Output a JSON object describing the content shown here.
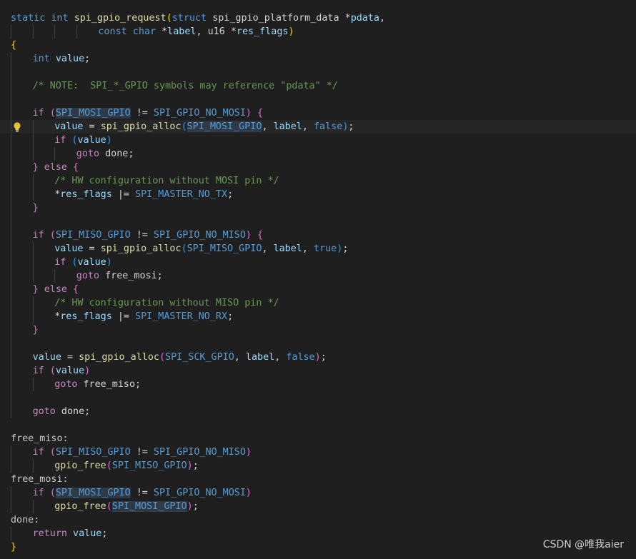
{
  "watermark": "CSDN @唯我aier",
  "colors": {
    "background": "#1f1f1f",
    "keyword": "#569cd6",
    "control": "#c586c0",
    "function": "#dcdcaa",
    "variable": "#9cdcfe",
    "comment": "#6a9955",
    "bracket_level_1": "#ffd700",
    "bracket_level_2": "#da70d6",
    "bracket_level_3": "#179fff"
  },
  "lightbulb_icon": "lightbulb-icon",
  "lightbulb_line": 9,
  "lines": [
    {
      "indent": 0,
      "tokens": [
        [
          "static",
          "kw"
        ],
        [
          " ",
          "txt"
        ],
        [
          "int",
          "kw"
        ],
        [
          " ",
          "txt"
        ],
        [
          "spi_gpio_request",
          "fn"
        ],
        [
          "(",
          "b1"
        ],
        [
          "struct",
          "kw"
        ],
        [
          " ",
          "txt"
        ],
        [
          "spi_gpio_platform_data",
          "txt"
        ],
        [
          " *",
          "txt"
        ],
        [
          "pdata",
          "var"
        ],
        [
          ",",
          "txt"
        ]
      ]
    },
    {
      "indent": 0,
      "tokens": [
        [
          "\t\t\t\t",
          "txt"
        ],
        [
          "const",
          "kw"
        ],
        [
          " ",
          "txt"
        ],
        [
          "char",
          "kw"
        ],
        [
          " *",
          "txt"
        ],
        [
          "label",
          "var"
        ],
        [
          ", u16 *",
          "txt"
        ],
        [
          "res_flags",
          "var"
        ],
        [
          ")",
          "b1"
        ]
      ]
    },
    {
      "indent": 0,
      "tokens": [
        [
          "{",
          "b1"
        ]
      ]
    },
    {
      "indent": 1,
      "tokens": [
        [
          "int",
          "kw"
        ],
        [
          " ",
          "txt"
        ],
        [
          "value",
          "var"
        ],
        [
          ";",
          "txt"
        ]
      ]
    },
    {
      "indent": 1,
      "tokens": []
    },
    {
      "indent": 1,
      "tokens": [
        [
          "/* NOTE:  SPI_*_GPIO symbols may reference \"pdata\" */",
          "cmt"
        ]
      ]
    },
    {
      "indent": 1,
      "tokens": []
    },
    {
      "indent": 1,
      "tokens": [
        [
          "if",
          "ctl"
        ],
        [
          " ",
          "txt"
        ],
        [
          "(",
          "b2"
        ],
        [
          "SPI_MOSI_GPIO",
          "mac-hl"
        ],
        [
          " != ",
          "txt"
        ],
        [
          "SPI_GPIO_NO_MOSI",
          "mac"
        ],
        [
          ")",
          "b2"
        ],
        [
          " ",
          "txt"
        ],
        [
          "{",
          "b2"
        ]
      ]
    },
    {
      "indent": 2,
      "current": true,
      "tokens": [
        [
          "value",
          "var"
        ],
        [
          " = ",
          "txt"
        ],
        [
          "spi_gpio_alloc",
          "fn"
        ],
        [
          "(",
          "b3"
        ],
        [
          "SPI_MOSI_GPIO",
          "mac-hl"
        ],
        [
          ", ",
          "txt"
        ],
        [
          "label",
          "var"
        ],
        [
          ", ",
          "txt"
        ],
        [
          "false",
          "kw"
        ],
        [
          ")",
          "b3"
        ],
        [
          ";",
          "txt"
        ]
      ]
    },
    {
      "indent": 2,
      "tokens": [
        [
          "if",
          "ctl"
        ],
        [
          " ",
          "txt"
        ],
        [
          "(",
          "b3"
        ],
        [
          "value",
          "var"
        ],
        [
          ")",
          "b3"
        ]
      ]
    },
    {
      "indent": 3,
      "tokens": [
        [
          "goto",
          "ctl"
        ],
        [
          " done;",
          "txt"
        ]
      ]
    },
    {
      "indent": 1,
      "tokens": [
        [
          "}",
          "b2"
        ],
        [
          " ",
          "txt"
        ],
        [
          "else",
          "ctl"
        ],
        [
          " ",
          "txt"
        ],
        [
          "{",
          "b2"
        ]
      ]
    },
    {
      "indent": 2,
      "tokens": [
        [
          "/* HW configuration without MOSI pin */",
          "cmt"
        ]
      ]
    },
    {
      "indent": 2,
      "tokens": [
        [
          "*",
          "txt"
        ],
        [
          "res_flags",
          "var"
        ],
        [
          " |= ",
          "txt"
        ],
        [
          "SPI_MASTER_NO_TX",
          "mac"
        ],
        [
          ";",
          "txt"
        ]
      ]
    },
    {
      "indent": 1,
      "tokens": [
        [
          "}",
          "b2"
        ]
      ]
    },
    {
      "indent": 1,
      "tokens": []
    },
    {
      "indent": 1,
      "tokens": [
        [
          "if",
          "ctl"
        ],
        [
          " ",
          "txt"
        ],
        [
          "(",
          "b2"
        ],
        [
          "SPI_MISO_GPIO",
          "mac"
        ],
        [
          " != ",
          "txt"
        ],
        [
          "SPI_GPIO_NO_MISO",
          "mac"
        ],
        [
          ")",
          "b2"
        ],
        [
          " ",
          "txt"
        ],
        [
          "{",
          "b2"
        ]
      ]
    },
    {
      "indent": 2,
      "tokens": [
        [
          "value",
          "var"
        ],
        [
          " = ",
          "txt"
        ],
        [
          "spi_gpio_alloc",
          "fn"
        ],
        [
          "(",
          "b3"
        ],
        [
          "SPI_MISO_GPIO",
          "mac"
        ],
        [
          ", ",
          "txt"
        ],
        [
          "label",
          "var"
        ],
        [
          ", ",
          "txt"
        ],
        [
          "true",
          "kw"
        ],
        [
          ")",
          "b3"
        ],
        [
          ";",
          "txt"
        ]
      ]
    },
    {
      "indent": 2,
      "tokens": [
        [
          "if",
          "ctl"
        ],
        [
          " ",
          "txt"
        ],
        [
          "(",
          "b3"
        ],
        [
          "value",
          "var"
        ],
        [
          ")",
          "b3"
        ]
      ]
    },
    {
      "indent": 3,
      "tokens": [
        [
          "goto",
          "ctl"
        ],
        [
          " free_mosi;",
          "txt"
        ]
      ]
    },
    {
      "indent": 1,
      "tokens": [
        [
          "}",
          "b2"
        ],
        [
          " ",
          "txt"
        ],
        [
          "else",
          "ctl"
        ],
        [
          " ",
          "txt"
        ],
        [
          "{",
          "b2"
        ]
      ]
    },
    {
      "indent": 2,
      "tokens": [
        [
          "/* HW configuration without MISO pin */",
          "cmt"
        ]
      ]
    },
    {
      "indent": 2,
      "tokens": [
        [
          "*",
          "txt"
        ],
        [
          "res_flags",
          "var"
        ],
        [
          " |= ",
          "txt"
        ],
        [
          "SPI_MASTER_NO_RX",
          "mac"
        ],
        [
          ";",
          "txt"
        ]
      ]
    },
    {
      "indent": 1,
      "tokens": [
        [
          "}",
          "b2"
        ]
      ]
    },
    {
      "indent": 1,
      "tokens": []
    },
    {
      "indent": 1,
      "tokens": [
        [
          "value",
          "var"
        ],
        [
          " = ",
          "txt"
        ],
        [
          "spi_gpio_alloc",
          "fn"
        ],
        [
          "(",
          "b2"
        ],
        [
          "SPI_SCK_GPIO",
          "mac"
        ],
        [
          ", ",
          "txt"
        ],
        [
          "label",
          "var"
        ],
        [
          ", ",
          "txt"
        ],
        [
          "false",
          "kw"
        ],
        [
          ")",
          "b2"
        ],
        [
          ";",
          "txt"
        ]
      ]
    },
    {
      "indent": 1,
      "tokens": [
        [
          "if",
          "ctl"
        ],
        [
          " ",
          "txt"
        ],
        [
          "(",
          "b2"
        ],
        [
          "value",
          "var"
        ],
        [
          ")",
          "b2"
        ]
      ]
    },
    {
      "indent": 2,
      "tokens": [
        [
          "goto",
          "ctl"
        ],
        [
          " free_miso;",
          "txt"
        ]
      ]
    },
    {
      "indent": 1,
      "tokens": []
    },
    {
      "indent": 1,
      "tokens": [
        [
          "goto",
          "ctl"
        ],
        [
          " done;",
          "txt"
        ]
      ]
    },
    {
      "indent": 0,
      "tokens": []
    },
    {
      "indent": 0,
      "tokens": [
        [
          "free_miso:",
          "lbl"
        ]
      ]
    },
    {
      "indent": 1,
      "tokens": [
        [
          "if",
          "ctl"
        ],
        [
          " ",
          "txt"
        ],
        [
          "(",
          "b2"
        ],
        [
          "SPI_MISO_GPIO",
          "mac"
        ],
        [
          " != ",
          "txt"
        ],
        [
          "SPI_GPIO_NO_MISO",
          "mac"
        ],
        [
          ")",
          "b2"
        ]
      ]
    },
    {
      "indent": 2,
      "tokens": [
        [
          "gpio_free",
          "fn"
        ],
        [
          "(",
          "b2"
        ],
        [
          "SPI_MISO_GPIO",
          "mac"
        ],
        [
          ")",
          "b2"
        ],
        [
          ";",
          "txt"
        ]
      ]
    },
    {
      "indent": 0,
      "tokens": [
        [
          "free_mosi:",
          "lbl"
        ]
      ]
    },
    {
      "indent": 1,
      "tokens": [
        [
          "if",
          "ctl"
        ],
        [
          " ",
          "txt"
        ],
        [
          "(",
          "b2"
        ],
        [
          "SPI_MOSI_GPIO",
          "mac-hl"
        ],
        [
          " != ",
          "txt"
        ],
        [
          "SPI_GPIO_NO_MOSI",
          "mac"
        ],
        [
          ")",
          "b2"
        ]
      ]
    },
    {
      "indent": 2,
      "tokens": [
        [
          "gpio_free",
          "fn"
        ],
        [
          "(",
          "b2"
        ],
        [
          "SPI_MOSI_GPIO",
          "mac-hl"
        ],
        [
          ")",
          "b2"
        ],
        [
          ";",
          "txt"
        ]
      ]
    },
    {
      "indent": 0,
      "tokens": [
        [
          "done:",
          "lbl"
        ]
      ]
    },
    {
      "indent": 1,
      "tokens": [
        [
          "return",
          "ctl"
        ],
        [
          " ",
          "txt"
        ],
        [
          "value",
          "var"
        ],
        [
          ";",
          "txt"
        ]
      ]
    },
    {
      "indent": 0,
      "tokens": [
        [
          "}",
          "b1"
        ]
      ]
    }
  ]
}
